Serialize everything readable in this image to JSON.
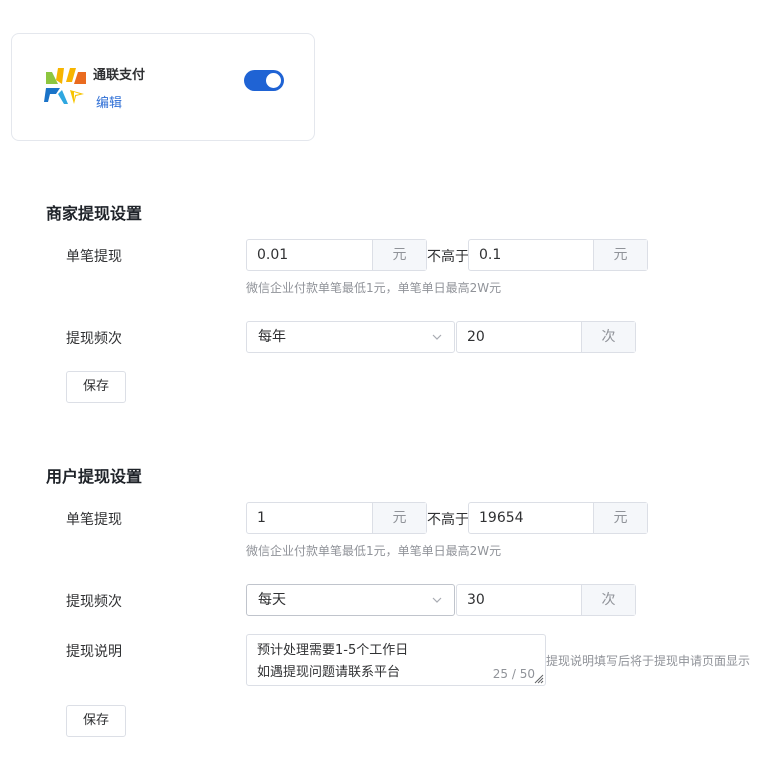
{
  "provider": {
    "name": "通联支付",
    "edit_label": "编辑",
    "enabled": true,
    "accent": "#1f63d4"
  },
  "merchant": {
    "title": "商家提现设置",
    "single_label": "单笔提现",
    "min_value": "0.01",
    "unit_yuan": "元",
    "not_above": "不高于",
    "max_value": "0.1",
    "hint": "微信企业付款单笔最低1元，单笔单日最高2W元",
    "freq_label": "提现频次",
    "freq_select": "每年",
    "freq_count": "20",
    "unit_times": "次",
    "save_label": "保存"
  },
  "user": {
    "title": "用户提现设置",
    "single_label": "单笔提现",
    "min_value": "1",
    "unit_yuan": "元",
    "not_above": "不高于",
    "max_value": "19654",
    "hint": "微信企业付款单笔最低1元，单笔单日最高2W元",
    "freq_label": "提现频次",
    "freq_select": "每天",
    "freq_count": "30",
    "unit_times": "次",
    "desc_label": "提现说明",
    "desc_line1": "预计处理需要1-5个工作日",
    "desc_line2": "如遇提现问题请联系平台",
    "desc_count": "25 / 50",
    "desc_hint": "提现说明填写后将于提现申请页面显示",
    "save_label": "保存"
  },
  "icons": [
    "allinpay-logo",
    "chevron-down-icon",
    "resize-grip-icon"
  ]
}
